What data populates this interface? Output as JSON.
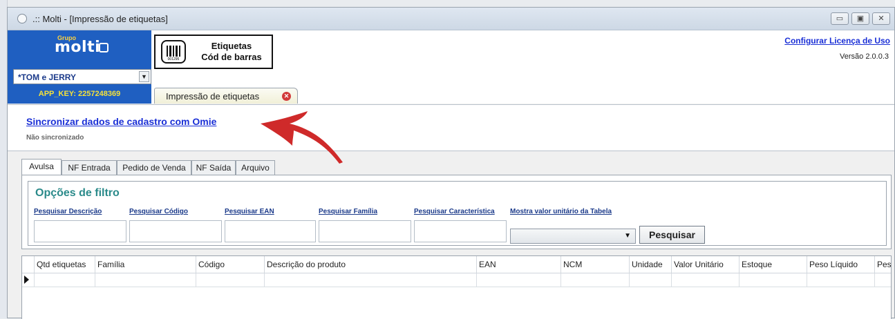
{
  "window": {
    "title": ".:: Molti - [Impressão de etiquetas]",
    "controls": {
      "minimize": "▭",
      "maximize": "▣",
      "close": "✕"
    }
  },
  "brand": {
    "logo_group": "Grupo",
    "logo_name": "molti",
    "company": "*TOM e JERRY",
    "app_key": "APP_KEY: 2257248369"
  },
  "module": {
    "title_line1": "Etiquetas",
    "title_line2": "Cód de barras",
    "barcode_number": "001295",
    "tab_label": "Impressão de etiquetas"
  },
  "header": {
    "license_link": "Configurar Licença de Uso",
    "version": "Versão 2.0.0.3"
  },
  "sync": {
    "link": "Sincronizar dados de cadastro com Omie",
    "status": "Não sincronizado"
  },
  "tabs": [
    "Avulsa",
    "NF Entrada",
    "Pedido de Venda",
    "NF Saída",
    "Arquivo"
  ],
  "filters": {
    "title": "Opções de filtro",
    "labels": {
      "descricao": "Pesquisar Descrição",
      "codigo": "Pesquisar Código",
      "ean": "Pesquisar EAN",
      "familia": "Pesquisar Família",
      "caracteristica": "Pesquisar Característica",
      "valor_tabela": "Mostra valor unitário da Tabela"
    },
    "values": {
      "descricao": "",
      "codigo": "",
      "ean": "",
      "familia": "",
      "caracteristica": "",
      "valor_tabela": ""
    },
    "search_button": "Pesquisar"
  },
  "grid": {
    "columns": [
      "Qtd etiquetas",
      "Família",
      "Código",
      "Descrição do produto",
      "EAN",
      "NCM",
      "Unidade",
      "Valor Unitário",
      "Estoque",
      "Peso Líquido",
      "Pes"
    ]
  },
  "colors": {
    "brand_blue": "#1f5fc1",
    "link_blue": "#1a2fd6",
    "appkey_yellow": "#f5e23a",
    "filter_title": "#2a8a8a",
    "arrow_red": "#cf2a2a"
  }
}
